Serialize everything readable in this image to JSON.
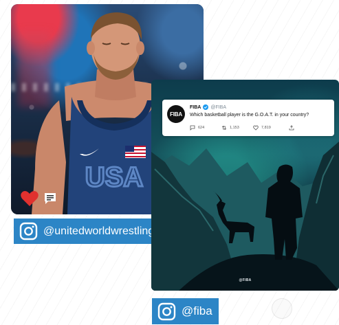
{
  "wrestling_card": {
    "singlet_text": "USA",
    "caption_handle": "@unitedworldwrestling"
  },
  "fiba_card": {
    "tweet": {
      "logo_text": "FIBA",
      "name": "FIBA",
      "handle": "@FIBA",
      "text": "Which basketball player is the G.O.A.T. in your country?",
      "replies": "624",
      "retweets": "1,153",
      "likes": "7,819"
    },
    "watermark": "@FIBA",
    "caption_handle": "@fiba"
  },
  "icons": {
    "instagram": "instagram-icon",
    "heart": "heart-icon",
    "comment": "comment-icon",
    "verified": "verified-icon",
    "reply": "reply-icon",
    "retweet": "retweet-icon",
    "like": "like-icon",
    "share": "share-icon"
  },
  "colors": {
    "label_blue": "#2c85c6",
    "heart_red": "#e0312f",
    "verified_blue": "#1d9bf0"
  }
}
